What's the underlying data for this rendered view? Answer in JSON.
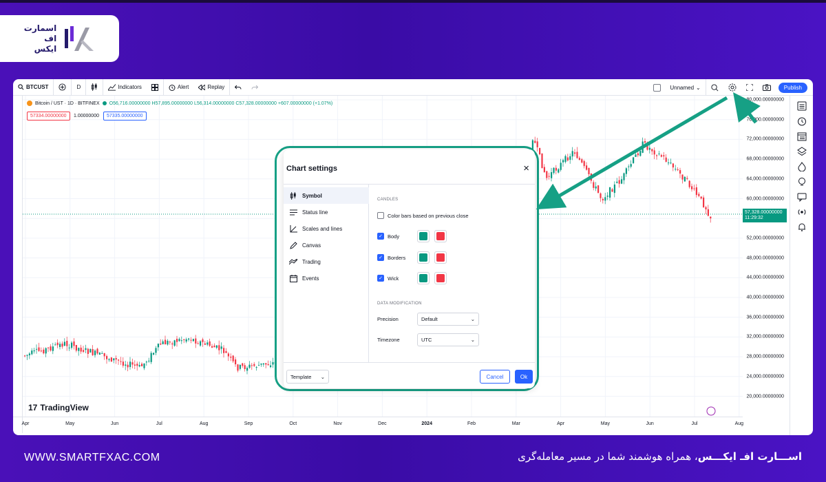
{
  "brand": {
    "logo_lines": [
      "اسمارت",
      "اف",
      "ایکس"
    ],
    "website": "WWW.SMARTFXAC.COM",
    "tagline_bold": "اســـارت افـ ایکـــس",
    "tagline_rest": "، همراه هوشمند شما در مسیر معامله‌گری"
  },
  "toolbar": {
    "symbol": "BTCUST",
    "interval": "D",
    "indicators": "Indicators",
    "alert": "Alert",
    "replay": "Replay",
    "layout_name": "Unnamed",
    "publish": "Publish"
  },
  "legend": {
    "title": "Bitcoin / UST · 1D · BITFINEX",
    "ohlc": "O56,716.00000000 H57,895.00000000 L56,314.00000000 C57,328.00000000 +607.00000000 (+1.07%)",
    "sell_price": "57334.00000000",
    "qty": "1.00000000",
    "buy_price": "57335.00000000"
  },
  "price_axis": {
    "ticks": [
      "80,000.00000000",
      "76,000.00000000",
      "72,000.00000000",
      "68,000.00000000",
      "64,000.00000000",
      "60,000.00000000",
      "56,000.00000000",
      "52,000.00000000",
      "48,000.00000000",
      "44,000.00000000",
      "40,000.00000000",
      "36,000.00000000",
      "32,000.00000000",
      "28,000.00000000",
      "24,000.00000000",
      "20,000.00000000"
    ],
    "current_price": "57,328.00000000",
    "countdown": "11:29:32"
  },
  "time_axis": {
    "ticks": [
      "Apr",
      "May",
      "Jun",
      "Jul",
      "Aug",
      "Sep",
      "Oct",
      "Nov",
      "Dec",
      "2024",
      "Feb",
      "Mar",
      "Apr",
      "May",
      "Jun",
      "Jul",
      "Aug"
    ]
  },
  "tradingview": "TradingView",
  "dialog": {
    "title": "Chart settings",
    "close": "×",
    "nav": [
      "Symbol",
      "Status line",
      "Scales and lines",
      "Canvas",
      "Trading",
      "Events"
    ],
    "section_candles": "CANDLES",
    "color_bars": "Color bars based on previous close",
    "rows": [
      "Body",
      "Borders",
      "Wick"
    ],
    "section_data": "DATA MODIFICATION",
    "precision_label": "Precision",
    "precision_value": "Default",
    "timezone_label": "Timezone",
    "timezone_value": "UTC",
    "template": "Template",
    "cancel": "Cancel",
    "ok": "Ok"
  },
  "colors": {
    "up": "#089981",
    "down": "#f23645",
    "accent": "#2962ff",
    "highlight": "#16a085"
  }
}
